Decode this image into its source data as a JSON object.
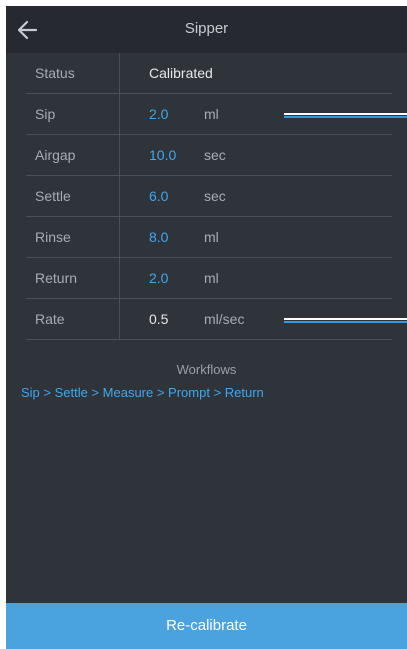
{
  "header": {
    "title": "Sipper",
    "back_icon": "arrow-left-icon"
  },
  "rows": [
    {
      "label": "Status",
      "value": "Calibrated",
      "unit": ""
    },
    {
      "label": "Sip",
      "value": "2.0",
      "unit": "ml"
    },
    {
      "label": "Airgap",
      "value": "10.0",
      "unit": "sec"
    },
    {
      "label": "Settle",
      "value": "6.0",
      "unit": "sec"
    },
    {
      "label": "Rinse",
      "value": "8.0",
      "unit": "ml"
    },
    {
      "label": "Return",
      "value": "2.0",
      "unit": "ml"
    },
    {
      "label": "Rate",
      "value": "0.5",
      "unit": "ml/sec"
    }
  ],
  "workflows": {
    "title": "Workflows",
    "link": "Sip > Settle > Measure > Prompt > Return"
  },
  "footer": {
    "button_label": "Re-calibrate"
  },
  "colors": {
    "background": "#2f343b",
    "header": "#262a30",
    "accent": "#3fa7f0",
    "button": "#4aa3de"
  }
}
